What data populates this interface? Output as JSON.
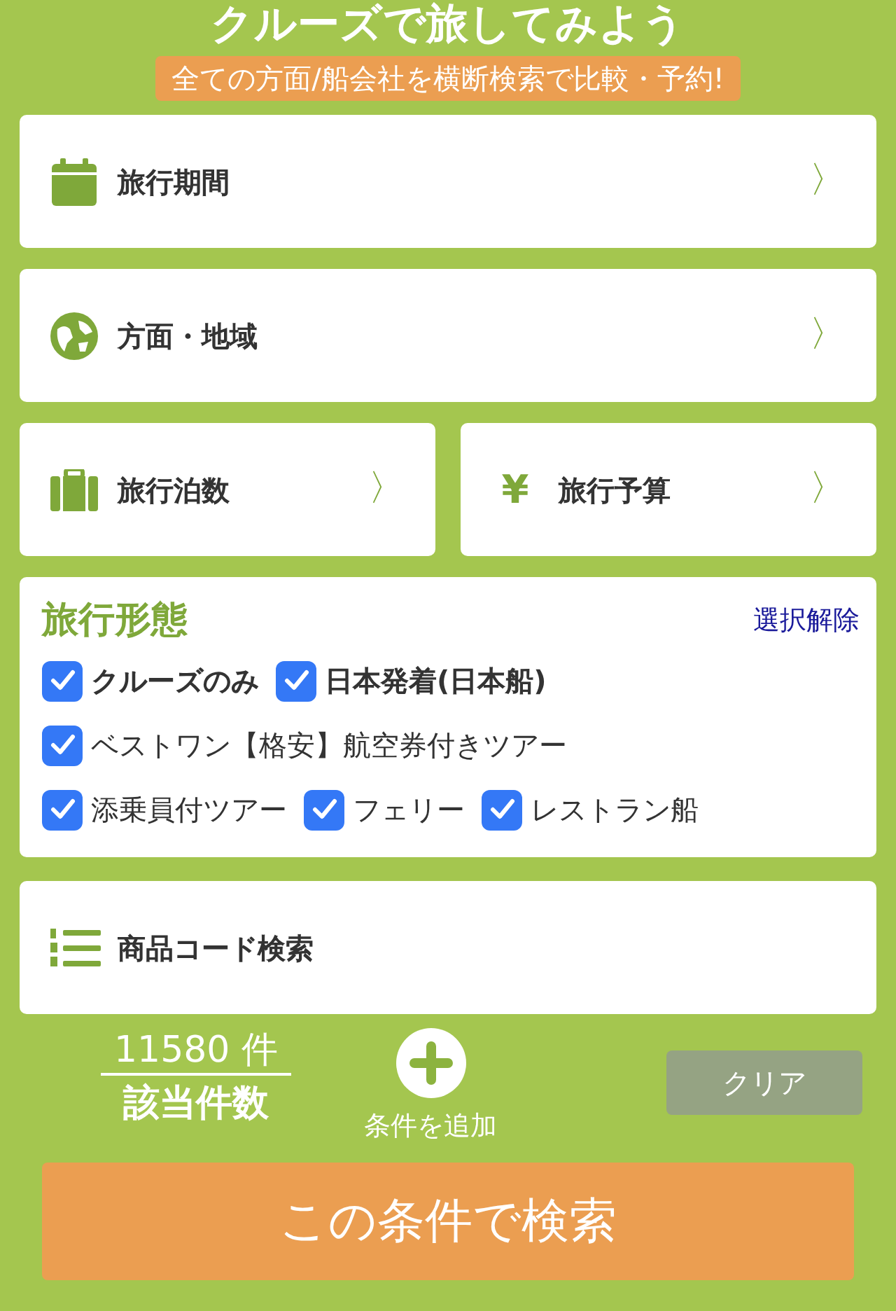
{
  "header": {
    "title": "クルーズで旅してみよう",
    "banner": "全ての方面/船会社を横断検索で比較・予約!"
  },
  "filter_rows": [
    [
      {
        "kind": "calendar",
        "label": "旅行期間",
        "chevron": "〉"
      }
    ],
    [
      {
        "kind": "globe",
        "label": "方面・地域",
        "chevron": "〉"
      }
    ],
    [
      {
        "kind": "suitcase",
        "label": "旅行泊数",
        "chevron": "〉"
      },
      {
        "kind": "yen",
        "symbol": "¥",
        "label": "旅行予算",
        "chevron": "〉"
      }
    ]
  ],
  "travel_type": {
    "title": "旅行形態",
    "clear_link": "選択解除",
    "options": [
      [
        {
          "label": "クルーズのみ",
          "checked": true,
          "bold": true
        },
        {
          "label": "日本発着(日本船)",
          "checked": true,
          "bold": true
        }
      ],
      [
        {
          "label": "ベストワン【格安】航空券付きツアー",
          "checked": true,
          "bold": false
        }
      ],
      [
        {
          "label": "添乗員付ツアー",
          "checked": true,
          "bold": false
        },
        {
          "label": "フェリー",
          "checked": true,
          "bold": false
        },
        {
          "label": "レストラン船",
          "checked": true,
          "bold": false
        }
      ]
    ]
  },
  "code_search": {
    "label": "商品コード検索"
  },
  "result": {
    "count": "11580 件",
    "count_label": "該当件数",
    "add_condition": "条件を追加",
    "clear_button": "クリア"
  },
  "search_button": "この条件で検索"
}
